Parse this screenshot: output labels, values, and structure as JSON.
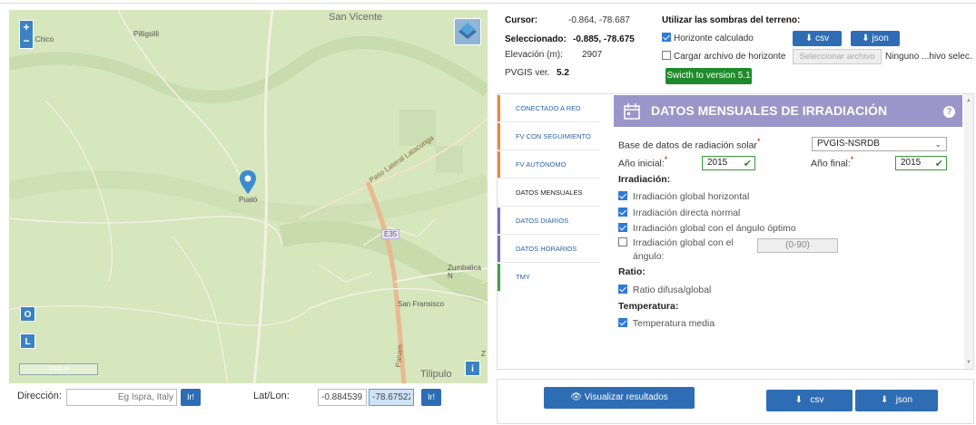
{
  "map": {
    "place_labels": {
      "san_vicente": "San Vicente",
      "la_chico": "a Chico",
      "pilligsilli": "Pilligsilli",
      "pualo": "Pualó",
      "paso_lateral": "Paso Lateral Latacunga",
      "e35": "E35",
      "zumbalica": "Zumbalica N",
      "san_fransisco": "San Fransisco",
      "tilipulo": "Tilipulo",
      "z": "Z",
      "panam": "Panam"
    },
    "zoom_in": "+",
    "zoom_out": "−",
    "btn_o": "O",
    "btn_l": "L",
    "btn_i": "i",
    "scale": "1000 m"
  },
  "address": {
    "direccion_label": "Dirección:",
    "direccion_placeholder": "Eg Ispra, Italy",
    "go_label": "Ir!",
    "latlon_label": "Lat/Lon:",
    "lat_value": "-0.884539",
    "lon_value": "-78.67522",
    "go2_label": "Ir!"
  },
  "info": {
    "cursor_label": "Cursor:",
    "cursor_value": "-0.864, -78.687",
    "selected_label": "Seleccionado:",
    "selected_value": "-0.885, -78.675",
    "elev_label": "Elevación (m):",
    "elev_value": "2907",
    "pvgis_label": "PVGIS ver.",
    "pvgis_value": "5.2",
    "shadows_title": "Utilizar las sombras del terreno:",
    "horizon_calc": "Horizonte calculado",
    "load_horizon": "Cargar archivo de horizonte",
    "select_file": "Seleccionar archivo",
    "no_file": "Ninguno ...hivo selec.",
    "csv": "csv",
    "json": "json",
    "switch_version": "Swicth to version 5.1"
  },
  "tabs": [
    {
      "label": "CONECTADO A RED",
      "color": "#e8893a"
    },
    {
      "label": "FV CON SEGUIMIENTO",
      "color": "#e8893a"
    },
    {
      "label": "FV AUTÓNOMO",
      "color": "#e8893a"
    },
    {
      "label": "DATOS MENSUALES",
      "color": "#ffffff"
    },
    {
      "label": "DATOS DIARIOS",
      "color": "#7b6fc0"
    },
    {
      "label": "DATOS HORARIOS",
      "color": "#7b6fc0"
    },
    {
      "label": "TMY",
      "color": "#3aa34a"
    }
  ],
  "panel": {
    "title": "DATOS MENSUALES DE IRRADIACIÓN",
    "help": "?",
    "db_label": "Base de datos de radiación solar",
    "db_value": "PVGIS-NSRDB",
    "start_label": "Año inicial:",
    "start_value": "2015",
    "end_label": "Año final:",
    "end_value": "2015",
    "irr_section": "Irradiación:",
    "irr_ghi": "Irradiación global horizontal",
    "irr_dni": "Irradiación directa normal",
    "irr_opt": "Irradiación global con el ángulo óptimo",
    "irr_angle_1": "Irradiación global con el",
    "irr_angle_2": "ángulo:",
    "angle_placeholder": "(0-90)",
    "ratio_section": "Ratio:",
    "ratio_diffuse": "Ratio difusa/global",
    "temp_section": "Temperatura:",
    "temp_mean": "Temperatura media"
  },
  "actions": {
    "visualize": "Visualizar resultados",
    "csv": "csv",
    "json": "json"
  },
  "colors": {
    "accent_blue": "#2e6db4",
    "header_purple": "#9b95c9",
    "green_button": "#1f8a2b",
    "map_bg": "#d9e8c0"
  }
}
